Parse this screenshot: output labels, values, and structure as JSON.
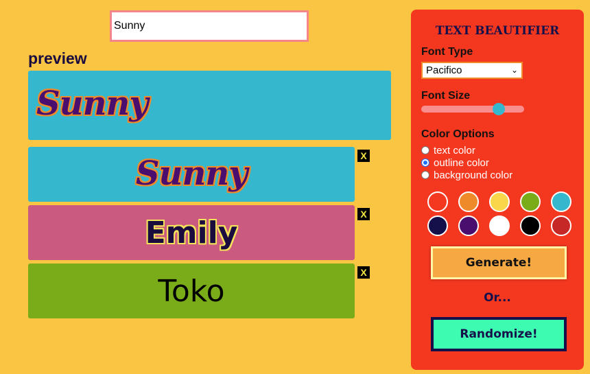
{
  "input": {
    "value": "Sunny"
  },
  "preview": {
    "title": "preview",
    "text": "Sunny"
  },
  "list": {
    "items": [
      {
        "text": "Sunny",
        "font": "Pacifico",
        "background": "#35b8cd",
        "text_color": "#4a0f6e",
        "outline_color": "#ef8a2a"
      },
      {
        "text": "Emily",
        "font": "Poppins bold",
        "background": "#ca5a80",
        "text_color": "#1b0c3f",
        "outline_color": "#f5e35a"
      },
      {
        "text": "Toko",
        "font": "Poppins",
        "background": "#7aac1a",
        "text_color": "#000000",
        "outline_color": "none"
      }
    ],
    "remove_label": "X"
  },
  "panel": {
    "title": "TEXT BEAUTIFIER",
    "font_type_label": "Font Type",
    "font_type_value": "Pacifico",
    "font_size_label": "Font Size",
    "font_size_fraction": 0.79,
    "color_options_label": "Color Options",
    "color_options": [
      {
        "label": "text color",
        "checked": false
      },
      {
        "label": "outline color",
        "checked": true
      },
      {
        "label": "background color",
        "checked": false
      }
    ],
    "swatches": [
      "#f43820",
      "#ef8a2a",
      "#f9d64a",
      "#7aac1a",
      "#35b8cd",
      "#16104a",
      "#4a0f6e",
      "#ffffff",
      "#000000",
      "#c62828"
    ],
    "generate_label": "Generate!",
    "or_label": "Or...",
    "randomize_label": "Randomize!"
  },
  "colors": {
    "page_bg": "#f9c542",
    "panel_bg": "#f43820"
  }
}
